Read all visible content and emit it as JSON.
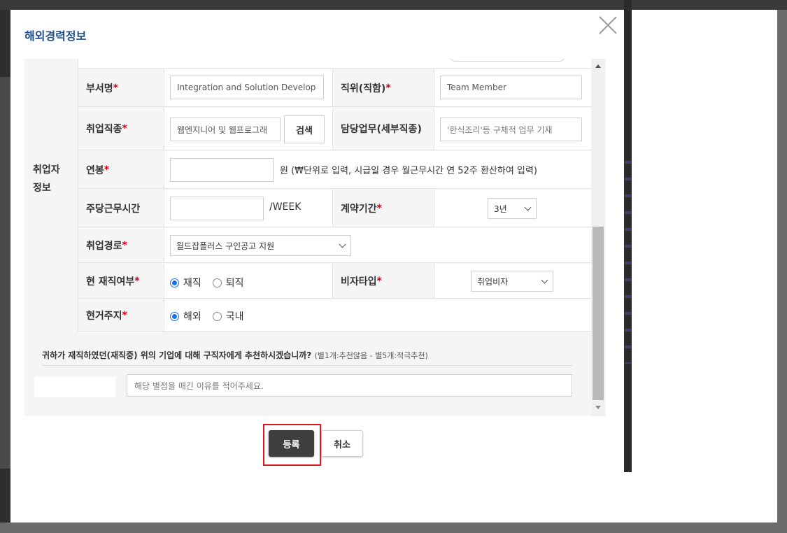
{
  "modal": {
    "title": "해외경력정보",
    "close_label": ""
  },
  "form": {
    "group_label": "취업자\n정보",
    "department": {
      "label": "부서명",
      "required": "*",
      "value": "Integration and Solution Develop"
    },
    "position": {
      "label": "직위(직함)",
      "required": "*",
      "value": "Team Member"
    },
    "job_type": {
      "label": "취업직종",
      "required": "*",
      "value": "웹엔지니어 및 웹프로그래",
      "search_button": "검색"
    },
    "duty": {
      "label": "담당업무(세부직종)",
      "placeholder": "'한식조리'등 구체적 업무 기재"
    },
    "salary": {
      "label": "연봉",
      "required": "*",
      "value": "",
      "hint": "원 (₩단위로 입력, 시급일 경우 월근무시간 연 52주 환산하여 입력)"
    },
    "weekly_hours": {
      "label": "주당근무시간",
      "value": "",
      "unit": "/WEEK"
    },
    "contract_period": {
      "label": "계약기간",
      "required": "*",
      "selected": "3년"
    },
    "employment_route": {
      "label": "취업경로",
      "required": "*",
      "selected": "월드잡플러스 구인공고 지원"
    },
    "employment_status": {
      "label": "현 재직여부",
      "required": "*",
      "options": [
        "재직",
        "퇴직"
      ],
      "selected": "재직"
    },
    "visa_type": {
      "label": "비자타입",
      "required": "*",
      "selected": "취업비자"
    },
    "residence": {
      "label": "현거주지",
      "required": "*",
      "options": [
        "해외",
        "국내"
      ],
      "selected": "해외"
    },
    "recommend": {
      "question": "귀하가 재직하였던(재직중) 위의 기업에 대해 구직자에게 추천하시겠습니까?",
      "scale": "(별1개:추천않음 - 별5개:적극추천)",
      "reason_placeholder": "해당 별점을 매긴 이유를 적어주세요."
    }
  },
  "footer": {
    "register_label": "등록",
    "cancel_label": "취소"
  },
  "colors": {
    "title": "#1f4e8c",
    "required": "#d0021b",
    "radio_on": "#1a73e8",
    "highlight": "#e0181e",
    "register_bg": "#3e3e3e"
  }
}
